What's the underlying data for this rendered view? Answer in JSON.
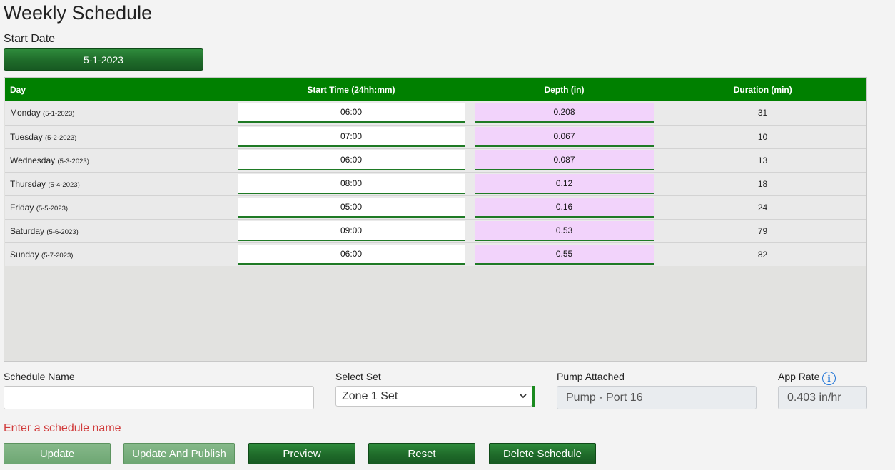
{
  "page": {
    "title": "Weekly Schedule",
    "start_date_label": "Start Date",
    "start_date_value": "5-1-2023"
  },
  "table": {
    "headers": [
      "Day",
      "Start Time (24hh:mm)",
      "Depth (in)",
      "Duration (min)"
    ],
    "rows": [
      {
        "day": "Monday",
        "date": "(5-1-2023)",
        "start_time": "06:00",
        "depth": "0.208",
        "duration": "31"
      },
      {
        "day": "Tuesday",
        "date": "(5-2-2023)",
        "start_time": "07:00",
        "depth": "0.067",
        "duration": "10"
      },
      {
        "day": "Wednesday",
        "date": "(5-3-2023)",
        "start_time": "06:00",
        "depth": "0.087",
        "duration": "13"
      },
      {
        "day": "Thursday",
        "date": "(5-4-2023)",
        "start_time": "08:00",
        "depth": "0.12",
        "duration": "18"
      },
      {
        "day": "Friday",
        "date": "(5-5-2023)",
        "start_time": "05:00",
        "depth": "0.16",
        "duration": "24"
      },
      {
        "day": "Saturday",
        "date": "(5-6-2023)",
        "start_time": "09:00",
        "depth": "0.53",
        "duration": "79"
      },
      {
        "day": "Sunday",
        "date": "(5-7-2023)",
        "start_time": "06:00",
        "depth": "0.55",
        "duration": "82"
      }
    ]
  },
  "form": {
    "schedule_name_label": "Schedule Name",
    "schedule_name_value": "",
    "select_set_label": "Select Set",
    "select_set_value": "Zone 1 Set",
    "pump_label": "Pump Attached",
    "pump_value": "Pump - Port 16",
    "app_rate_label": "App Rate",
    "app_rate_value": "0.403 in/hr",
    "info_icon": "info-icon",
    "error_message": "Enter a schedule name"
  },
  "buttons": {
    "update": "Update",
    "update_publish": "Update And Publish",
    "preview": "Preview",
    "reset": "Reset",
    "delete": "Delete Schedule"
  },
  "colors": {
    "header_green": "#008000",
    "button_green": "#1f6b2a",
    "depth_bg": "#f2d3fb",
    "error_red": "#d13b3b",
    "info_blue": "#1e73d6"
  }
}
